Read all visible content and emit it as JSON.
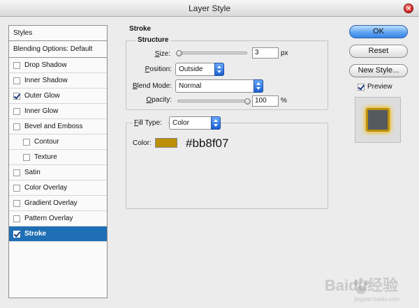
{
  "window": {
    "title": "Layer Style"
  },
  "styles_panel": {
    "header": "Styles",
    "blending_options": "Blending Options: Default",
    "items": [
      {
        "label": "Drop Shadow",
        "checked": false,
        "indent": false,
        "selected": false
      },
      {
        "label": "Inner Shadow",
        "checked": false,
        "indent": false,
        "selected": false
      },
      {
        "label": "Outer Glow",
        "checked": true,
        "indent": false,
        "selected": false
      },
      {
        "label": "Inner Glow",
        "checked": false,
        "indent": false,
        "selected": false
      },
      {
        "label": "Bevel and Emboss",
        "checked": false,
        "indent": false,
        "selected": false
      },
      {
        "label": "Contour",
        "checked": false,
        "indent": true,
        "selected": false
      },
      {
        "label": "Texture",
        "checked": false,
        "indent": true,
        "selected": false
      },
      {
        "label": "Satin",
        "checked": false,
        "indent": false,
        "selected": false
      },
      {
        "label": "Color Overlay",
        "checked": false,
        "indent": false,
        "selected": false
      },
      {
        "label": "Gradient Overlay",
        "checked": false,
        "indent": false,
        "selected": false
      },
      {
        "label": "Pattern Overlay",
        "checked": false,
        "indent": false,
        "selected": false
      },
      {
        "label": "Stroke",
        "checked": true,
        "indent": false,
        "selected": true
      }
    ]
  },
  "stroke": {
    "section_title": "Stroke",
    "structure_title": "Structure",
    "size": {
      "label": "Size:",
      "value": "3",
      "unit": "px",
      "slider_fraction": 0.02
    },
    "position": {
      "label": "Position:",
      "value": "Outside"
    },
    "blend_mode": {
      "label": "Blend Mode:",
      "value": "Normal"
    },
    "opacity": {
      "label": "Opacity:",
      "value": "100",
      "unit": "%",
      "slider_fraction": 1.0
    },
    "fill_type": {
      "label": "Fill Type:",
      "value": "Color"
    },
    "color": {
      "label": "Color:",
      "hex_text": "#bb8f07",
      "swatch": "#bb8f07"
    }
  },
  "buttons": {
    "ok": "OK",
    "reset": "Reset",
    "new_style": "New Style...",
    "preview_label": "Preview",
    "preview_checked": true
  },
  "watermark": {
    "text": "Baidu经验",
    "sub": "jingyan.baidu.com"
  }
}
